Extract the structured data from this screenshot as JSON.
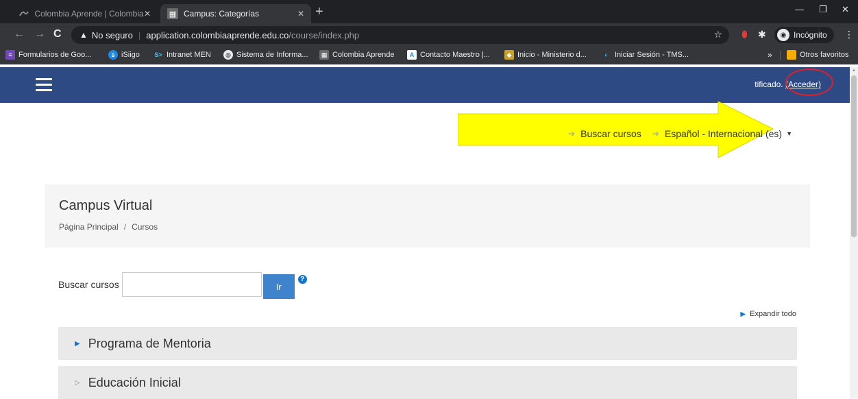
{
  "browser": {
    "tabs": [
      {
        "title": "Colombia Aprende | Colombia Ap",
        "active": false
      },
      {
        "title": "Campus: Categorías",
        "active": true
      }
    ],
    "address": {
      "security_label": "No seguro",
      "host": "application.colombiaaprende.edu.co",
      "path": "/course/index.php"
    },
    "profile_label": "Incógnito",
    "bookmarks": [
      "Formularios de Goo...",
      "iSiigo",
      "Intranet MEN",
      "Sistema de Informa...",
      "Colombia Aprende",
      "Contacto Maestro |...",
      "Inicio - Ministerio d...",
      "Iniciar Sesión - TMS..."
    ],
    "bookmarks_more": "»",
    "other_bookmarks": "Otros favoritos"
  },
  "navbar": {
    "login_prefix": "tificado.",
    "login_link": "(Acceder)"
  },
  "toplinks": {
    "search_courses": "Buscar cursos",
    "language": "Español - Internacional (es)"
  },
  "header": {
    "title": "Campus Virtual",
    "breadcrumb": [
      "Página Principal",
      "Cursos"
    ]
  },
  "search": {
    "label": "Buscar cursos",
    "value": "",
    "go_label": "Ir"
  },
  "expand_all": "Expandir todo",
  "categories": [
    {
      "name": "Programa de Mentoria",
      "has_children": true
    },
    {
      "name": "Educación Inicial",
      "has_children": false
    }
  ],
  "colors": {
    "navbar": "#2e4a84",
    "accent": "#1177d1",
    "annotation_arrow": "#ffff00",
    "annotation_circle": "#e0202a"
  }
}
